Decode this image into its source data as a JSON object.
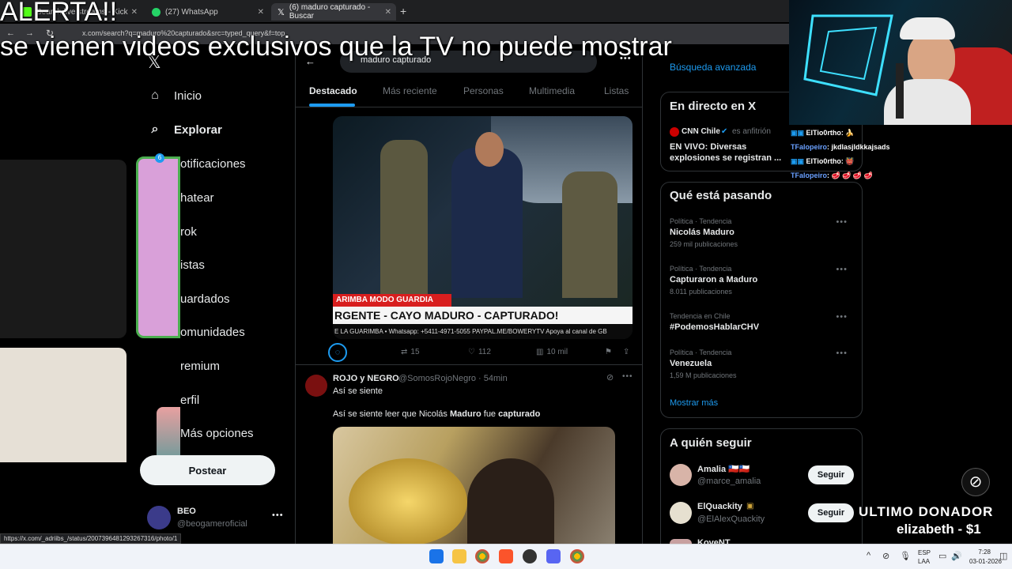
{
  "browser": {
    "tabs": [
      {
        "label": "Search live streams - Kick"
      },
      {
        "label": "(27) WhatsApp"
      },
      {
        "label": "(6) maduro capturado - Buscar"
      }
    ],
    "new_tab": "+",
    "url": "x.com/search?q=maduro%20capturado&src=typed_query&f=top",
    "status_url": "https://x.com/_adriibs_/status/2007396481293267316/photo/1"
  },
  "overlay": {
    "alert": "ALERTA!!",
    "subtitle": "se vienen videos exclusivos que la TV no puede mostrar",
    "donor_title": "ULTIMO DONADOR",
    "donor_name": "elizabeth - $1"
  },
  "nav": {
    "items": [
      {
        "label": "Inicio",
        "icon": "⌂"
      },
      {
        "label": "Explorar",
        "icon": "⌕"
      },
      {
        "label": "otificaciones",
        "icon": ""
      },
      {
        "label": "hatear",
        "icon": ""
      },
      {
        "label": "rok",
        "icon": ""
      },
      {
        "label": "istas",
        "icon": ""
      },
      {
        "label": "uardados",
        "icon": ""
      },
      {
        "label": "omunidades",
        "icon": ""
      },
      {
        "label": "remium",
        "icon": ""
      },
      {
        "label": "erfil",
        "icon": ""
      },
      {
        "label": "Más opciones",
        "icon": ""
      }
    ],
    "notif_badge": "6",
    "post_button": "Postear",
    "profile_name": "BEO",
    "profile_handle": "@beogameroficial"
  },
  "search": {
    "query": "maduro capturado",
    "tabs": [
      "Destacado",
      "Más reciente",
      "Personas",
      "Multimedia",
      "Listas"
    ]
  },
  "post1": {
    "image_banner1": "ARIMBA MODO GUARDIA",
    "image_banner2": "RGENTE - CAYO MADURO - CAPTURADO!",
    "image_ticker": "E LA GUARIMBA • Whatsapp: +5411-4971-5055    PAYPAL.ME/BOWERYTV    Apoya al canal de GB",
    "retweets": "15",
    "likes": "112",
    "views": "10 mil"
  },
  "post2": {
    "author": "ROJO y NEGRO",
    "handle": "@SomosRojoNegro · 54min",
    "line1": "Así se siente",
    "line2_pre": "Así se siente leer que Nicolás ",
    "line2_bold1": "Maduro",
    "line2_mid": " fue ",
    "line2_bold2": "capturado"
  },
  "right": {
    "advanced": "Búsqueda avanzada",
    "live_title": "En directo en X",
    "live_host": "CNN Chile",
    "live_host_role": "es anfitrión",
    "live_text": "EN VIVO: Diversas explosiones se registran ...",
    "trending_title": "Qué está pasando",
    "trends": [
      {
        "category": "Política · Tendencia",
        "name": "Nicolás Maduro",
        "count": "259 mil publicaciones"
      },
      {
        "category": "Política · Tendencia",
        "name": "Capturaron a Maduro",
        "count": "8.011 publicaciones"
      },
      {
        "category": "Tendencia en Chile",
        "name": "#PodemosHablarCHV",
        "count": ""
      },
      {
        "category": "Política · Tendencia",
        "name": "Venezuela",
        "count": "1,59 M publicaciones"
      }
    ],
    "show_more": "Mostrar más",
    "follow_title": "A quién seguir",
    "follow": [
      {
        "name": "Amalia 🇨🇱🇨🇱",
        "handle": "@marce_amalia",
        "button": "Seguir"
      },
      {
        "name": "ElQuackity",
        "handle": "@ElAlexQuackity",
        "button": "Seguir"
      },
      {
        "name": "KoveNT",
        "handle": "",
        "button": ""
      }
    ]
  },
  "chat": [
    {
      "user": "ElTio0rtho",
      "msg": ": 🍌"
    },
    {
      "user": "TFalopeiro",
      "msg": ": jkdlasjldkkajsads"
    },
    {
      "user": "ElTio0rtho",
      "msg": ": 👹"
    },
    {
      "user": "TFalopeiro",
      "msg": ": 🥩 🥩 🥩 🥩"
    }
  ],
  "taskbar": {
    "lang1": "ESP",
    "lang2": "LAA",
    "time": "7:28",
    "date": "03-01-2026"
  },
  "colors": {
    "accent": "#1d9bf0",
    "bg": "#000000",
    "border": "#2f3336",
    "muted": "#71767b"
  }
}
